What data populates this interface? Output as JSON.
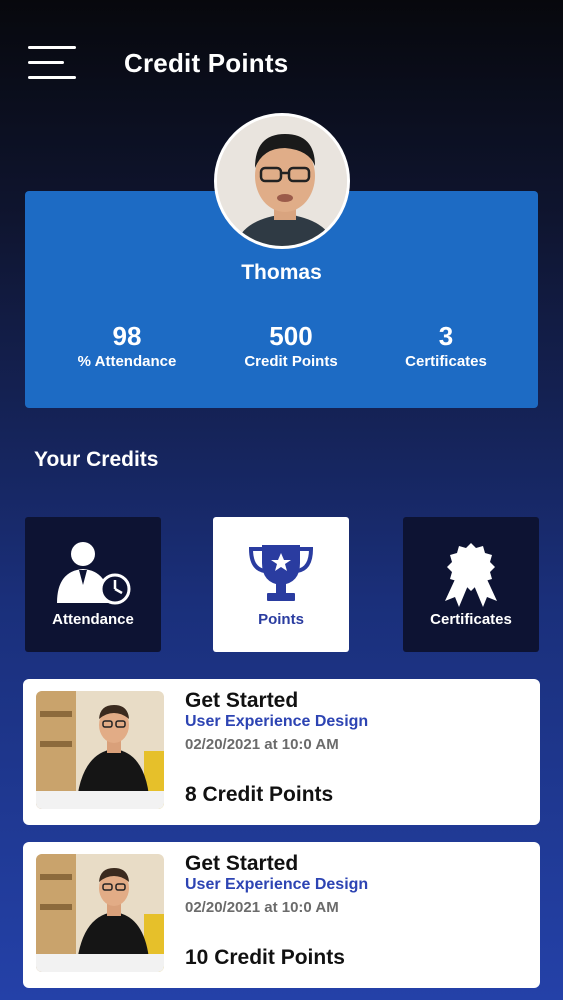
{
  "header": {
    "title": "Credit Points",
    "menu_icon": "hamburger-menu-icon"
  },
  "profile": {
    "name": "Thomas",
    "stats": [
      {
        "value": "98",
        "label": "% Attendance"
      },
      {
        "value": "500",
        "label": "Credit Points"
      },
      {
        "value": "3",
        "label": "Certificates"
      }
    ]
  },
  "section": {
    "title": "Your Credits"
  },
  "tiles": [
    {
      "label": "Attendance",
      "icon": "person-clock-icon",
      "active": false
    },
    {
      "label": "Points",
      "icon": "trophy-icon",
      "active": true
    },
    {
      "label": "Certificates",
      "icon": "award-ribbon-icon",
      "active": false
    }
  ],
  "courses": [
    {
      "title": "Get Started",
      "subtitle": "User Experience Design",
      "date": "02/20/2021 at 10:0 AM",
      "points": "8 Credit Points"
    },
    {
      "title": "Get Started",
      "subtitle": "User Experience Design",
      "date": "02/20/2021 at 10:0 AM",
      "points": "10 Credit Points"
    }
  ],
  "colors": {
    "card_blue": "#1d6bc4",
    "tile_dark": "#0d1333",
    "accent_blue": "#2d44b3"
  }
}
